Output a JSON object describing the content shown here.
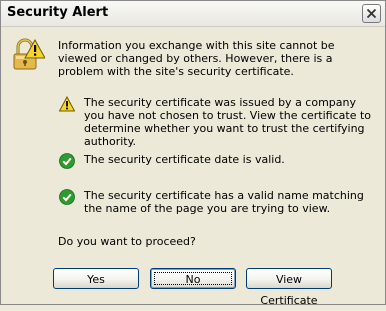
{
  "window": {
    "title": "Security Alert",
    "close_icon": "close-icon"
  },
  "dialog": {
    "main_icon": "lock-warning-icon",
    "intro_text": "Information you exchange with this site cannot be viewed or changed by others. However, there is a problem with the site's security certificate.",
    "items": [
      {
        "icon": "warning-icon",
        "status": "warning",
        "text": "The security certificate was issued by a company you have not chosen to trust. View the certificate to determine whether you want to trust the certifying authority."
      },
      {
        "icon": "checkmark-icon",
        "status": "ok",
        "text": "The security certificate date is valid."
      },
      {
        "icon": "checkmark-icon",
        "status": "ok",
        "text": "The security certificate has a valid name matching the name of the page you are trying to view."
      }
    ],
    "question": "Do you want to proceed?"
  },
  "buttons": {
    "yes": "Yes",
    "no": "No",
    "view_certificate": "View Certificate",
    "focused": "no"
  },
  "colors": {
    "warning_yellow": "#f6d32d",
    "ok_green": "#2e9b2e",
    "button_border": "#003c74",
    "dialog_bg": "#ece9d8"
  }
}
